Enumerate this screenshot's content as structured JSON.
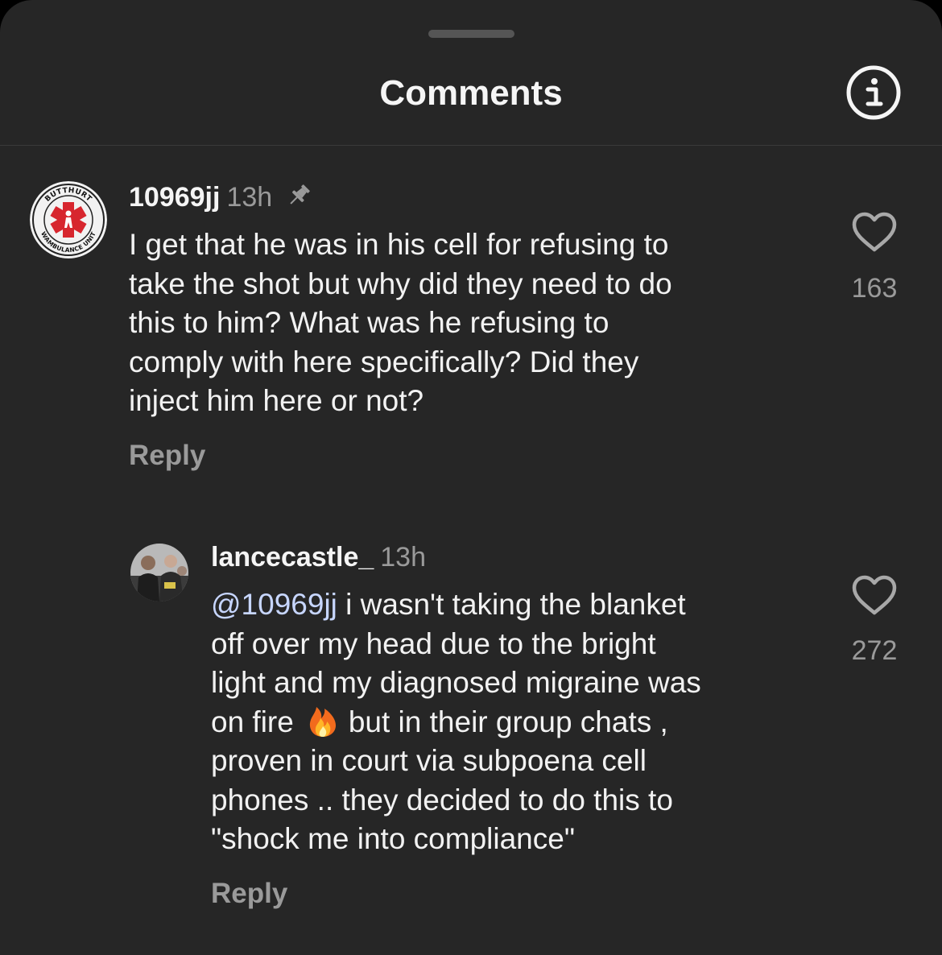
{
  "header": {
    "title": "Comments",
    "info_icon": "info-icon"
  },
  "comments": [
    {
      "username": "10969jj",
      "time": "13h",
      "pinned": true,
      "avatar": "butthurt-wambulance-unit-logo",
      "avatar_text_top": "BUTTHURT",
      "avatar_text_bottom": "WAMBULANCE UNIT",
      "lines": [
        "I get that he was in his cell for refusing to",
        "take the shot but why did they need to do",
        "this to him? What was he refusing to",
        "comply with here specifically? Did they",
        "inject him here or not?"
      ],
      "reply_label": "Reply",
      "like_count": "163",
      "like_icon": "heart-outline-icon"
    },
    {
      "username": "lancecastle_",
      "time": "13h",
      "avatar": "photo-avatar",
      "mention": "@10969jj",
      "line1_rest": " i wasn't  taking the blanket",
      "line2": "off over my head due to the bright",
      "line3": "light and my diagnosed migraine was",
      "line4_before": "on fire",
      "emoji": "fire-emoji",
      "line4_after": "but in their group chats ,",
      "line5": "proven in court via subpoena cell",
      "line6": "phones .. they decided to do this to",
      "line7": "\"shock me into compliance\"",
      "reply_label": "Reply",
      "like_count": "272",
      "like_icon": "heart-outline-icon"
    }
  ],
  "colors": {
    "background": "#262626",
    "text": "#f2f2f2",
    "secondary": "#9a9a9a",
    "mention": "#c7d6ff"
  }
}
